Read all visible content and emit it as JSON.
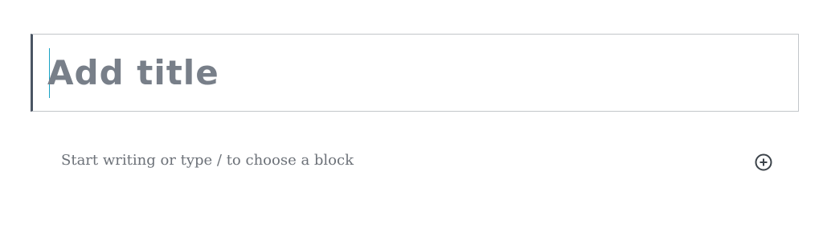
{
  "editor": {
    "title_placeholder": "Add title",
    "paragraph_placeholder": "Start writing or type / to choose a block",
    "add_block_icon": "plus-circle-icon"
  },
  "colors": {
    "title_text": "#787f89",
    "paragraph_text": "#6c7178",
    "cursor": "#19a3c4",
    "title_left_border": "#4a5563",
    "title_border": "#c3c6ca",
    "icon": "#3c434a"
  }
}
